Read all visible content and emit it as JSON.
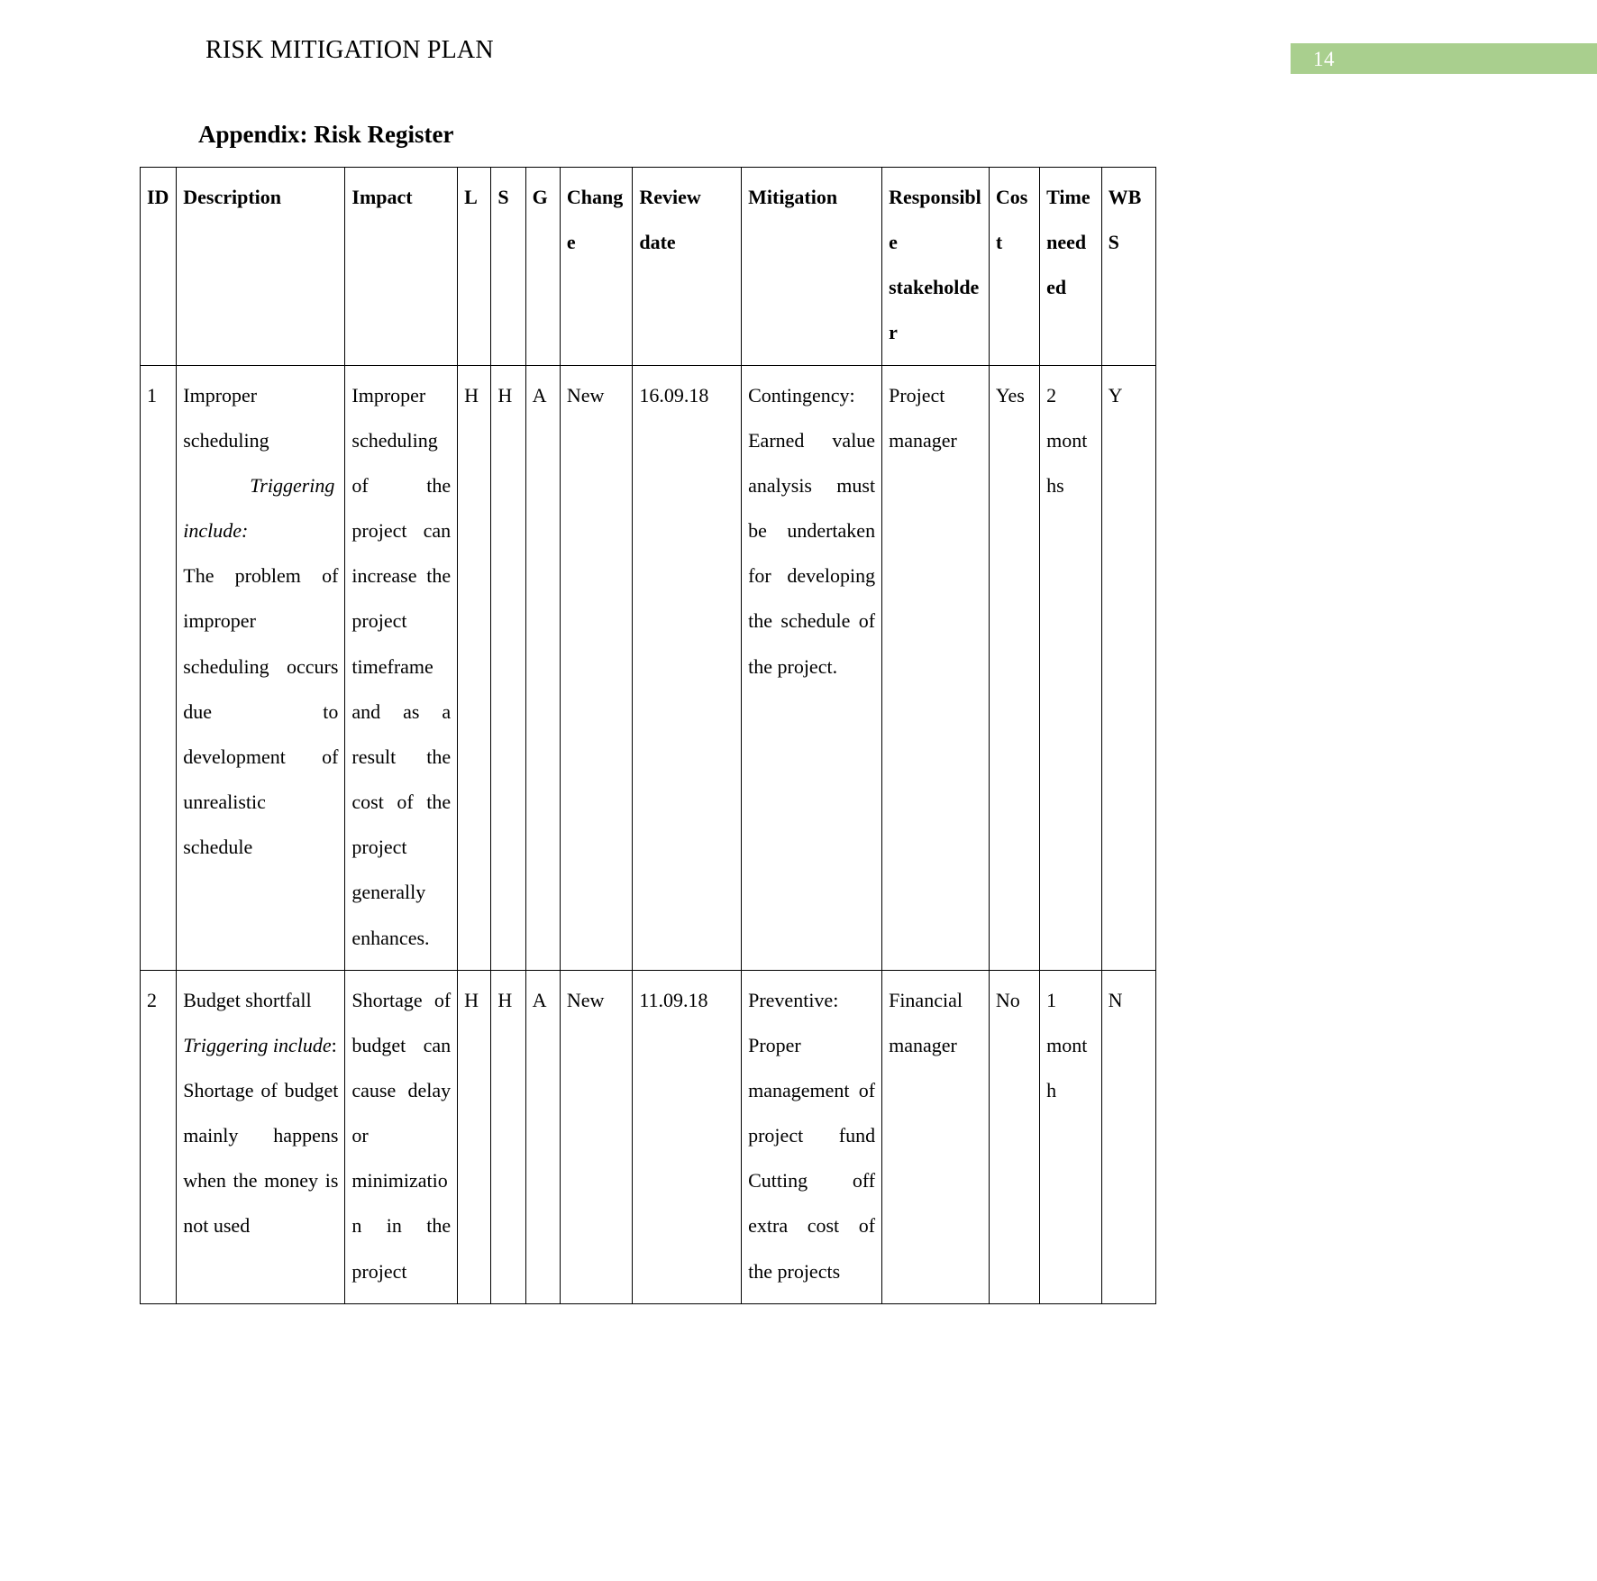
{
  "page": {
    "running_header": "RISK MITIGATION PLAN",
    "page_number": "14",
    "banner_color": "#a9cf8e",
    "appendix_title": "Appendix: Risk Register"
  },
  "table": {
    "headers": {
      "id": "ID",
      "description": "Description",
      "impact": "Impact",
      "l": "L",
      "s": "S",
      "g": "G",
      "change": "Change",
      "review_date": "Review date",
      "mitigation": "Mitigation",
      "responsible_stakeholder": "Responsible stakeholder",
      "cost": "Cost",
      "time_needed": "Time needed",
      "wbs": "WBS"
    },
    "rows": [
      {
        "id": "1",
        "description_title": "Improper scheduling",
        "description_trigger_label": "Triggering include:",
        "description_body": "The problem of improper scheduling occurs due to development of unrealistic schedule",
        "impact": "Improper scheduling of the project can increase the project timeframe and as a result the cost of the project generally enhances.",
        "l": "H",
        "s": "H",
        "g": "A",
        "change": "New",
        "review_date": "16.09.18",
        "mitigation": "Contingency: Earned value analysis must be undertaken for developing the schedule of the project.",
        "responsible_stakeholder": "Project manager",
        "cost": "Yes",
        "time_needed": "2 months",
        "wbs": "Y"
      },
      {
        "id": "2",
        "description_title": "Budget shortfall",
        "description_trigger_label": "Triggering include",
        "description_trigger_colon": ":",
        "description_body": "Shortage of budget mainly happens when the money is not used",
        "impact": "Shortage of budget can cause delay or minimization in the project",
        "l": "H",
        "s": "H",
        "g": "A",
        "change": "New",
        "review_date": "11.09.18",
        "mitigation": "Preventive: Proper management of project fund Cutting off extra cost of the projects",
        "responsible_stakeholder": "Financial manager",
        "cost": "No",
        "time_needed": "1 month",
        "wbs": "N"
      }
    ]
  }
}
